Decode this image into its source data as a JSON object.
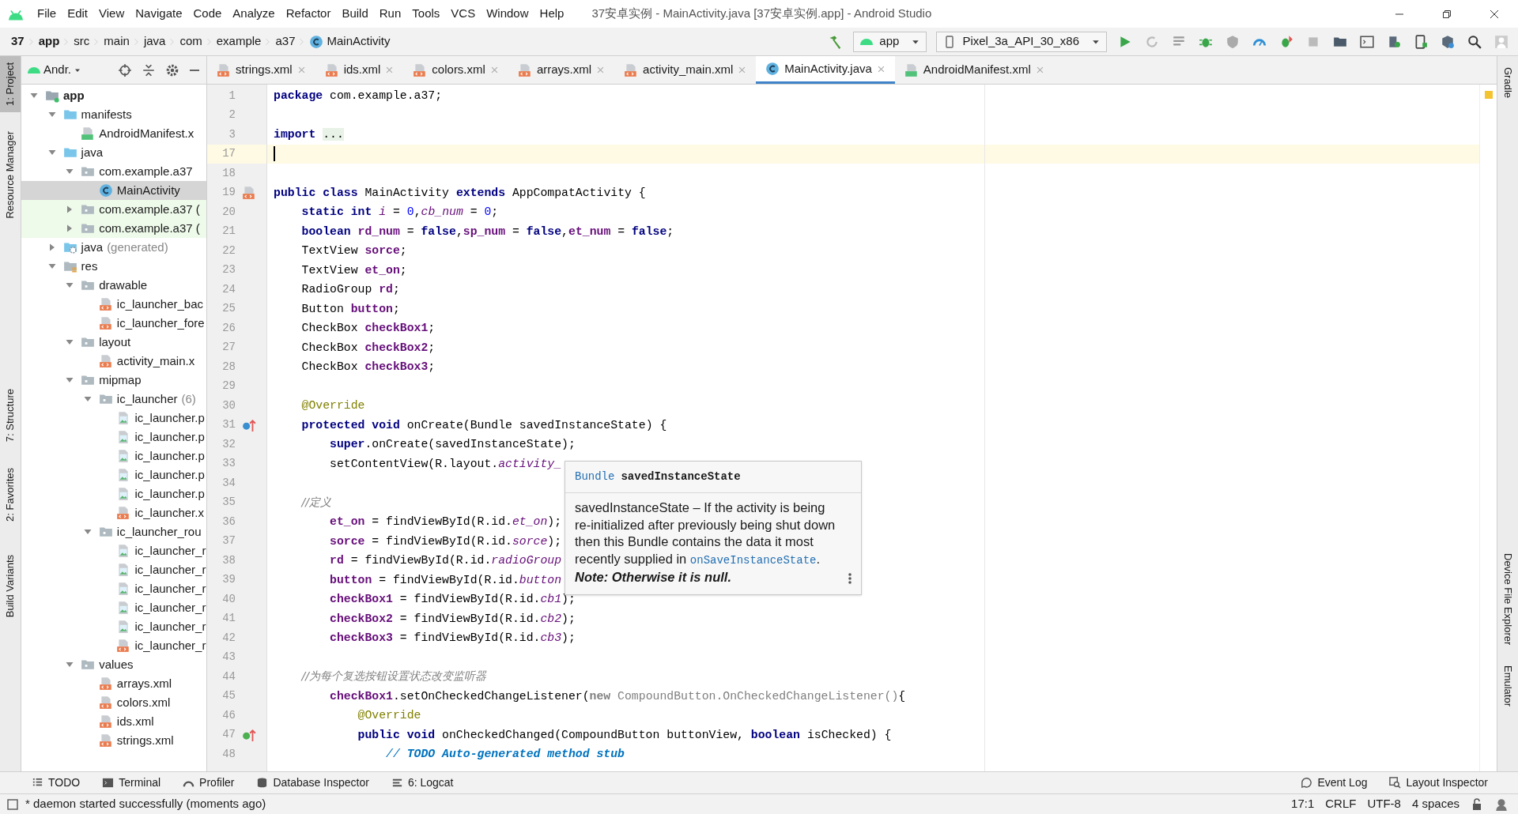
{
  "window": {
    "title": "37安卓实例 - MainActivity.java [37安卓实例.app] - Android Studio"
  },
  "menu": [
    "File",
    "Edit",
    "View",
    "Navigate",
    "Code",
    "Analyze",
    "Refactor",
    "Build",
    "Run",
    "Tools",
    "VCS",
    "Window",
    "Help"
  ],
  "breadcrumbs": [
    {
      "label": "37",
      "bold": true
    },
    {
      "label": "app",
      "bold": true
    },
    {
      "label": "src",
      "bold": false
    },
    {
      "label": "main",
      "bold": false
    },
    {
      "label": "java",
      "bold": false
    },
    {
      "label": "com",
      "bold": false
    },
    {
      "label": "example",
      "bold": false
    },
    {
      "label": "a37",
      "bold": false
    },
    {
      "label": "MainActivity",
      "bold": false,
      "kind": "class"
    }
  ],
  "toolbar": {
    "config": "app",
    "device": "Pixel_3a_API_30_x86"
  },
  "left_strip": [
    {
      "label": "1: Project",
      "selected": true
    },
    {
      "label": "Resource Manager",
      "selected": false
    },
    {
      "label": "7: Structure",
      "selected": false
    },
    {
      "label": "2: Favorites",
      "selected": false
    },
    {
      "label": "Build Variants",
      "selected": false
    }
  ],
  "right_strip": [
    {
      "label": "Gradle"
    },
    {
      "label": "Device File Explorer"
    },
    {
      "label": "Emulator"
    }
  ],
  "project_panel": {
    "view": "Andr.",
    "tree": [
      {
        "label": "app",
        "kind": "module",
        "expanded": true,
        "selected": false,
        "children": [
          {
            "label": "manifests",
            "kind": "source-folder",
            "expanded": true,
            "selected": false,
            "children": [
              {
                "label": "AndroidManifest.x",
                "kind": "manifest",
                "selected": false
              }
            ]
          },
          {
            "label": "java",
            "kind": "source-folder",
            "expanded": true,
            "selected": false,
            "children": [
              {
                "label": "com.example.a37",
                "kind": "package",
                "expanded": true,
                "selected": false,
                "children": [
                  {
                    "label": "MainActivity",
                    "kind": "class",
                    "selected": true
                  }
                ]
              },
              {
                "label": "com.example.a37 (",
                "kind": "test-package",
                "expanded": false,
                "selected": false
              },
              {
                "label": "com.example.a37 (",
                "kind": "test-package",
                "expanded": false,
                "selected": false
              }
            ]
          },
          {
            "label": "java",
            "note": "(generated)",
            "kind": "generated",
            "expanded": false,
            "selected": false
          },
          {
            "label": "res",
            "kind": "res",
            "expanded": true,
            "selected": false,
            "children": [
              {
                "label": "drawable",
                "kind": "package",
                "expanded": true,
                "selected": false,
                "children": [
                  {
                    "label": "ic_launcher_bac",
                    "kind": "xml",
                    "selected": false
                  },
                  {
                    "label": "ic_launcher_fore",
                    "kind": "xml",
                    "selected": false
                  }
                ]
              },
              {
                "label": "layout",
                "kind": "package",
                "expanded": true,
                "selected": false,
                "children": [
                  {
                    "label": "activity_main.x",
                    "kind": "xml",
                    "selected": false
                  }
                ]
              },
              {
                "label": "mipmap",
                "kind": "package",
                "expanded": true,
                "selected": false,
                "children": [
                  {
                    "label": "ic_launcher",
                    "note": "(6)",
                    "kind": "package",
                    "expanded": true,
                    "selected": false,
                    "children": [
                      {
                        "label": "ic_launcher.p",
                        "kind": "image",
                        "selected": false
                      },
                      {
                        "label": "ic_launcher.p",
                        "kind": "image",
                        "selected": false
                      },
                      {
                        "label": "ic_launcher.p",
                        "kind": "image",
                        "selected": false
                      },
                      {
                        "label": "ic_launcher.p",
                        "kind": "image",
                        "selected": false
                      },
                      {
                        "label": "ic_launcher.p",
                        "kind": "image",
                        "selected": false
                      },
                      {
                        "label": "ic_launcher.x",
                        "kind": "xml",
                        "selected": false
                      }
                    ]
                  },
                  {
                    "label": "ic_launcher_rou",
                    "kind": "package",
                    "expanded": true,
                    "selected": false,
                    "children": [
                      {
                        "label": "ic_launcher_r",
                        "kind": "image",
                        "selected": false
                      },
                      {
                        "label": "ic_launcher_r",
                        "kind": "image",
                        "selected": false
                      },
                      {
                        "label": "ic_launcher_r",
                        "kind": "image",
                        "selected": false
                      },
                      {
                        "label": "ic_launcher_r",
                        "kind": "image",
                        "selected": false
                      },
                      {
                        "label": "ic_launcher_r",
                        "kind": "image",
                        "selected": false
                      },
                      {
                        "label": "ic_launcher_r",
                        "kind": "xml",
                        "selected": false
                      }
                    ]
                  }
                ]
              },
              {
                "label": "values",
                "kind": "package",
                "expanded": true,
                "selected": false,
                "children": [
                  {
                    "label": "arrays.xml",
                    "kind": "xml",
                    "selected": false
                  },
                  {
                    "label": "colors.xml",
                    "kind": "xml",
                    "selected": false
                  },
                  {
                    "label": "ids.xml",
                    "kind": "xml",
                    "selected": false
                  },
                  {
                    "label": "strings.xml",
                    "kind": "xml",
                    "selected": false
                  }
                ]
              }
            ]
          }
        ]
      }
    ]
  },
  "tabs": [
    {
      "label": "strings.xml",
      "kind": "xml",
      "selected": false
    },
    {
      "label": "ids.xml",
      "kind": "xml",
      "selected": false
    },
    {
      "label": "colors.xml",
      "kind": "xml",
      "selected": false
    },
    {
      "label": "arrays.xml",
      "kind": "xml",
      "selected": false
    },
    {
      "label": "activity_main.xml",
      "kind": "xml",
      "selected": false
    },
    {
      "label": "MainActivity.java",
      "kind": "class",
      "selected": true
    },
    {
      "label": "AndroidManifest.xml",
      "kind": "manifest",
      "selected": false
    }
  ],
  "editor": {
    "lines": [
      {
        "n": "1",
        "code": [
          {
            "text": "package",
            "kind": "kw"
          },
          {
            "text": " com.example.a37;",
            "kind": "p"
          }
        ]
      },
      {
        "n": "2"
      },
      {
        "n": "3",
        "code": [
          {
            "text": "import ",
            "kind": "kw"
          },
          {
            "text": "...",
            "kind": "fold"
          }
        ]
      },
      {
        "n": "17",
        "current": true
      },
      {
        "n": "18"
      },
      {
        "n": "19",
        "kind": "xml",
        "code": [
          {
            "text": "public class",
            "kind": "kw"
          },
          {
            "text": " MainActivity ",
            "kind": "p"
          },
          {
            "text": "extends",
            "kind": "kw"
          },
          {
            "text": " AppCompatActivity {",
            "kind": "p"
          }
        ]
      },
      {
        "n": "20",
        "code": [
          {
            "text": "    static int ",
            "kind": "kw"
          },
          {
            "text": "i",
            "kind": "st"
          },
          {
            "text": " = ",
            "kind": "p"
          },
          {
            "text": "0",
            "kind": "num"
          },
          {
            "text": ",",
            "kind": "p"
          },
          {
            "text": "cb_num",
            "kind": "st"
          },
          {
            "text": " = ",
            "kind": "p"
          },
          {
            "text": "0",
            "kind": "num"
          },
          {
            "text": ";",
            "kind": "p"
          }
        ]
      },
      {
        "n": "21",
        "code": [
          {
            "text": "    boolean ",
            "kind": "kw"
          },
          {
            "text": "rd_num",
            "kind": "fd"
          },
          {
            "text": " = ",
            "kind": "p"
          },
          {
            "text": "false",
            "kind": "kw"
          },
          {
            "text": ",",
            "kind": "p"
          },
          {
            "text": "sp_num",
            "kind": "fd"
          },
          {
            "text": " = ",
            "kind": "p"
          },
          {
            "text": "false",
            "kind": "kw"
          },
          {
            "text": ",",
            "kind": "p"
          },
          {
            "text": "et_num",
            "kind": "fd"
          },
          {
            "text": " = ",
            "kind": "p"
          },
          {
            "text": "false",
            "kind": "kw"
          },
          {
            "text": ";",
            "kind": "p"
          }
        ]
      },
      {
        "n": "22",
        "code": [
          {
            "text": "    TextView ",
            "kind": "p"
          },
          {
            "text": "sorce",
            "kind": "fd"
          },
          {
            "text": ";",
            "kind": "p"
          }
        ]
      },
      {
        "n": "23",
        "code": [
          {
            "text": "    TextView ",
            "kind": "p"
          },
          {
            "text": "et_on",
            "kind": "fd"
          },
          {
            "text": ";",
            "kind": "p"
          }
        ]
      },
      {
        "n": "24",
        "code": [
          {
            "text": "    RadioGroup ",
            "kind": "p"
          },
          {
            "text": "rd",
            "kind": "fd"
          },
          {
            "text": ";",
            "kind": "p"
          }
        ]
      },
      {
        "n": "25",
        "code": [
          {
            "text": "    Button ",
            "kind": "p"
          },
          {
            "text": "button",
            "kind": "fd"
          },
          {
            "text": ";",
            "kind": "p"
          }
        ]
      },
      {
        "n": "26",
        "code": [
          {
            "text": "    CheckBox ",
            "kind": "p"
          },
          {
            "text": "checkBox1",
            "kind": "fd"
          },
          {
            "text": ";",
            "kind": "p"
          }
        ]
      },
      {
        "n": "27",
        "code": [
          {
            "text": "    CheckBox ",
            "kind": "p"
          },
          {
            "text": "checkBox2",
            "kind": "fd"
          },
          {
            "text": ";",
            "kind": "p"
          }
        ]
      },
      {
        "n": "28",
        "code": [
          {
            "text": "    CheckBox ",
            "kind": "p"
          },
          {
            "text": "checkBox3",
            "kind": "fd"
          },
          {
            "text": ";",
            "kind": "p"
          }
        ]
      },
      {
        "n": "29"
      },
      {
        "n": "30",
        "code": [
          {
            "text": "    @Override",
            "kind": "ann"
          }
        ]
      },
      {
        "n": "31",
        "kind": "override",
        "code": [
          {
            "text": "    protected void",
            "kind": "kw"
          },
          {
            "text": " onCreate(Bundle savedInstanceState) {",
            "kind": "p"
          }
        ]
      },
      {
        "n": "32",
        "code": [
          {
            "text": "        super",
            "kind": "kw"
          },
          {
            "text": ".onCreate(savedInstanceState);",
            "kind": "p"
          }
        ]
      },
      {
        "n": "33",
        "code": [
          {
            "text": "        setContentView(R.layout.",
            "kind": "p"
          },
          {
            "text": "activity_",
            "kind": "st"
          }
        ]
      },
      {
        "n": "34"
      },
      {
        "n": "35",
        "code": [
          {
            "text": "        //定义",
            "kind": "cm"
          }
        ]
      },
      {
        "n": "36",
        "code": [
          {
            "text": "        et_on",
            "kind": "fd"
          },
          {
            "text": " = findViewById(R.id.",
            "kind": "p"
          },
          {
            "text": "et_on",
            "kind": "st"
          },
          {
            "text": ");",
            "kind": "p"
          }
        ]
      },
      {
        "n": "37",
        "code": [
          {
            "text": "        sorce",
            "kind": "fd"
          },
          {
            "text": " = findViewById(R.id.",
            "kind": "p"
          },
          {
            "text": "sorce",
            "kind": "st"
          },
          {
            "text": ");",
            "kind": "p"
          }
        ]
      },
      {
        "n": "38",
        "code": [
          {
            "text": "        rd",
            "kind": "fd"
          },
          {
            "text": " = findViewById(R.id.",
            "kind": "p"
          },
          {
            "text": "radioGroup",
            "kind": "st"
          }
        ]
      },
      {
        "n": "39",
        "code": [
          {
            "text": "        button",
            "kind": "fd"
          },
          {
            "text": " = findViewById(R.id.",
            "kind": "p"
          },
          {
            "text": "button",
            "kind": "st"
          }
        ]
      },
      {
        "n": "40",
        "code": [
          {
            "text": "        checkBox1",
            "kind": "fd"
          },
          {
            "text": " = findViewById(R.id.",
            "kind": "p"
          },
          {
            "text": "cb1",
            "kind": "st"
          },
          {
            "text": ");",
            "kind": "p"
          }
        ]
      },
      {
        "n": "41",
        "code": [
          {
            "text": "        checkBox2",
            "kind": "fd"
          },
          {
            "text": " = findViewById(R.id.",
            "kind": "p"
          },
          {
            "text": "cb2",
            "kind": "st"
          },
          {
            "text": ");",
            "kind": "p"
          }
        ]
      },
      {
        "n": "42",
        "code": [
          {
            "text": "        checkBox3",
            "kind": "fd"
          },
          {
            "text": " = findViewById(R.id.",
            "kind": "p"
          },
          {
            "text": "cb3",
            "kind": "st"
          },
          {
            "text": ");",
            "kind": "p"
          }
        ]
      },
      {
        "n": "43"
      },
      {
        "n": "44",
        "code": [
          {
            "text": "        //为每个复选按钮设置状态改变监听器",
            "kind": "cm"
          }
        ]
      },
      {
        "n": "45",
        "code": [
          {
            "text": "        checkBox1",
            "kind": "fd"
          },
          {
            "text": ".setOnCheckedChangeListener(",
            "kind": "p"
          },
          {
            "text": "new",
            "kind": "gkw"
          },
          {
            "text": " CompoundButton.OnCheckedChangeListener()",
            "kind": "gr"
          },
          {
            "text": "{",
            "kind": "p"
          }
        ]
      },
      {
        "n": "46",
        "code": [
          {
            "text": "            @Override",
            "kind": "ann"
          }
        ]
      },
      {
        "n": "47",
        "kind": "implements",
        "code": [
          {
            "text": "            public void",
            "kind": "kw"
          },
          {
            "text": " onCheckedChanged(CompoundButton buttonView, ",
            "kind": "p"
          },
          {
            "text": "boolean",
            "kind": "kw"
          },
          {
            "text": " isChecked) {",
            "kind": "p"
          }
        ]
      },
      {
        "n": "48",
        "code": [
          {
            "text": "                // ",
            "kind": "todo-slash"
          },
          {
            "text": "TODO Auto-generated method stub",
            "kind": "todo"
          }
        ]
      }
    ]
  },
  "doc_popup": {
    "type": "Bundle",
    "name": "savedInstanceState",
    "body": [
      {
        "text": "savedInstanceState – If the activity is being re-initialized after previously being shut down then this Bundle contains the data it most recently supplied in ",
        "kind": "plain"
      },
      {
        "text": "onSaveInstanceState",
        "kind": "link"
      },
      {
        "text": ".",
        "kind": "plain"
      },
      {
        "text": " Note: Otherwise it is null.",
        "kind": "emphasis"
      }
    ]
  },
  "bottom_tools": [
    {
      "label": "TODO",
      "kind": "list"
    },
    {
      "label": "Terminal",
      "kind": "terminal"
    },
    {
      "label": "Profiler",
      "kind": "gauge"
    },
    {
      "label": "Database Inspector",
      "kind": "database"
    },
    {
      "label": "6: Logcat",
      "kind": "lines"
    }
  ],
  "bottom_tools_right": [
    {
      "label": "Event Log",
      "kind": "bubble"
    },
    {
      "label": "Layout Inspector",
      "kind": "inspect"
    }
  ],
  "status_bar": {
    "message": "* daemon started successfully (moments ago)",
    "position": "17:1",
    "line_separator": "CRLF",
    "encoding": "UTF-8",
    "indent": "4 spaces"
  }
}
